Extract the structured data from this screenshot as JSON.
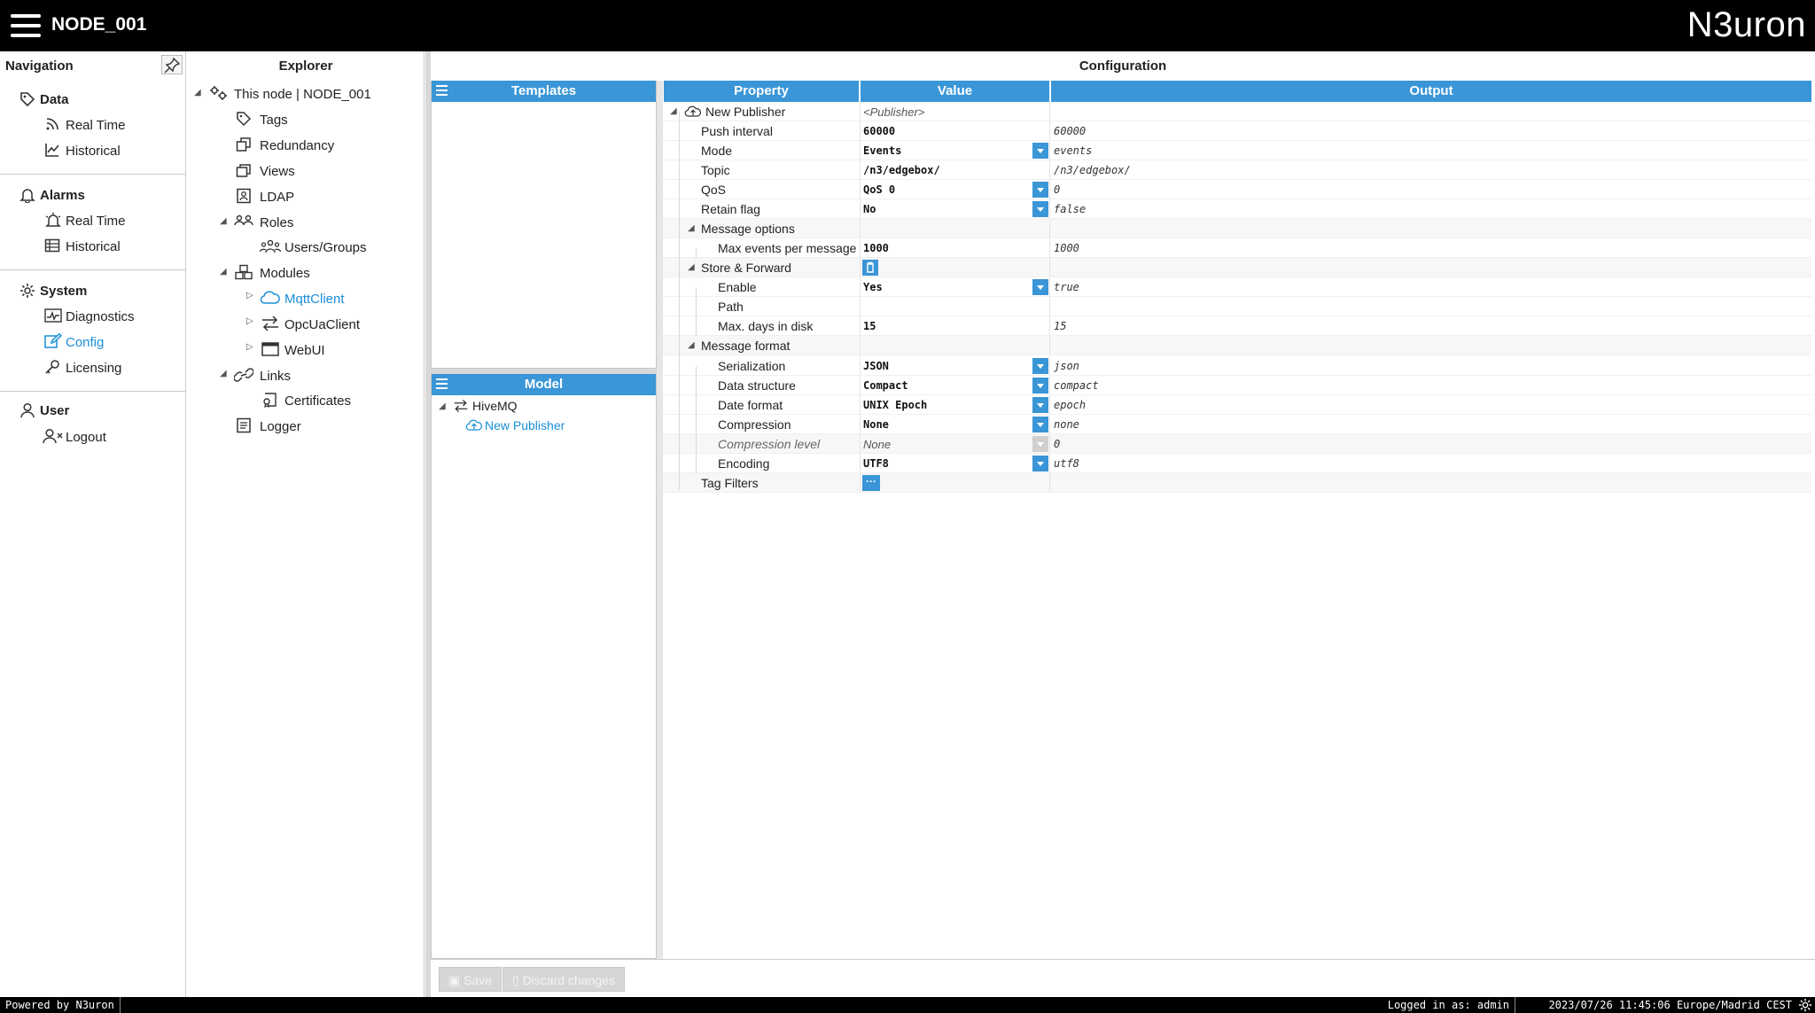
{
  "header": {
    "title": "NODE_001",
    "logo": "N3uron"
  },
  "navigation": {
    "title": "Navigation",
    "sections": [
      {
        "label": "Data",
        "icon": "tag-icon",
        "items": [
          {
            "label": "Real Time",
            "icon": "rss-icon"
          },
          {
            "label": "Historical",
            "icon": "line-chart-icon"
          }
        ]
      },
      {
        "label": "Alarms",
        "icon": "bell-icon",
        "items": [
          {
            "label": "Real Time",
            "icon": "alarm-realtime-icon"
          },
          {
            "label": "Historical",
            "icon": "table-icon"
          }
        ]
      },
      {
        "label": "System",
        "icon": "gear-icon",
        "items": [
          {
            "label": "Diagnostics",
            "icon": "pulse-icon"
          },
          {
            "label": "Config",
            "icon": "edit-icon"
          },
          {
            "label": "Licensing",
            "icon": "key-icon"
          }
        ]
      },
      {
        "label": "User",
        "icon": "user-icon",
        "items": [
          {
            "label": "Logout",
            "icon": "user-x-icon"
          }
        ]
      }
    ]
  },
  "explorer": {
    "title": "Explorer",
    "items": [
      "This node | NODE_001",
      "Tags",
      "Redundancy",
      "Views",
      "LDAP",
      "Roles",
      "Users/Groups",
      "Modules",
      "MqttClient",
      "OpcUaClient",
      "WebUI",
      "Links",
      "Certificates",
      "Logger"
    ]
  },
  "configuration": {
    "title": "Configuration",
    "templates_header": "Templates",
    "model_header": "Model",
    "model_tree": [
      "HiveMQ",
      "New Publisher"
    ],
    "columns": [
      "Property",
      "Value",
      "Output"
    ],
    "rows": [
      {
        "property": "New Publisher",
        "value": "<Publisher>",
        "output": ""
      },
      {
        "property": "Push interval",
        "value": "60000",
        "output": "60000"
      },
      {
        "property": "Mode",
        "value": "Events",
        "output": "events"
      },
      {
        "property": "Topic",
        "value": "/n3/edgebox/",
        "output": "/n3/edgebox/"
      },
      {
        "property": "QoS",
        "value": "QoS 0",
        "output": "0"
      },
      {
        "property": "Retain flag",
        "value": "No",
        "output": "false"
      },
      {
        "property": "Message options",
        "value": "",
        "output": ""
      },
      {
        "property": "Max events per message",
        "value": "1000",
        "output": "1000"
      },
      {
        "property": "Store & Forward",
        "value": "",
        "output": ""
      },
      {
        "property": "Enable",
        "value": "Yes",
        "output": "true"
      },
      {
        "property": "Path",
        "value": "",
        "output": ""
      },
      {
        "property": "Max. days in disk",
        "value": "15",
        "output": "15"
      },
      {
        "property": "Message format",
        "value": "",
        "output": ""
      },
      {
        "property": "Serialization",
        "value": "JSON",
        "output": "json"
      },
      {
        "property": "Data structure",
        "value": "Compact",
        "output": "compact"
      },
      {
        "property": "Date format",
        "value": "UNIX Epoch",
        "output": "epoch"
      },
      {
        "property": "Compression",
        "value": "None",
        "output": "none"
      },
      {
        "property": "Compression level",
        "value": "None",
        "output": "0"
      },
      {
        "property": "Encoding",
        "value": "UTF8",
        "output": "utf8"
      },
      {
        "property": "Tag Filters",
        "value": "",
        "output": ""
      }
    ],
    "save_label": "Save",
    "discard_label": "Discard changes"
  },
  "status_bar": {
    "powered_by": "Powered by N3uron",
    "logged_in": "Logged in as: admin",
    "datetime": "2023/07/26 11:45:06 Europe/Madrid CEST"
  },
  "colors": {
    "accent": "#3a96d6",
    "active_link": "#1a8fd8",
    "header_bg": "#000000"
  }
}
